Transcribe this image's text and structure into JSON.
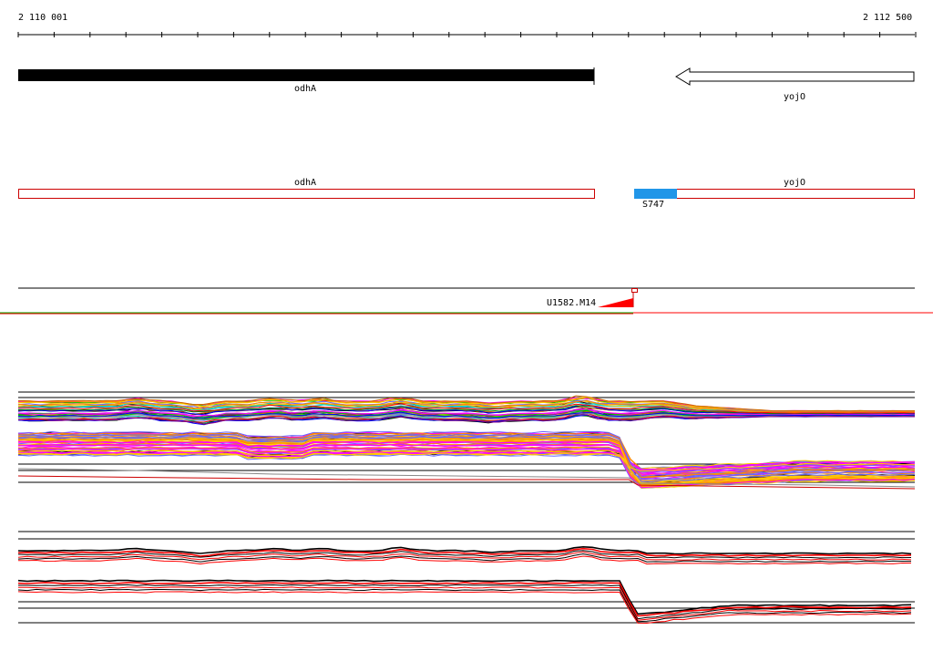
{
  "ruler": {
    "start_label": "2 110 001",
    "end_label": "2 112 500"
  },
  "genes": [
    {
      "name": "odhA",
      "strand": "+"
    },
    {
      "name": "yojO",
      "strand": "-"
    }
  ],
  "transcript_track": {
    "segments": [
      {
        "name": "odhA"
      },
      {
        "name": "yojO"
      }
    ],
    "feature": {
      "name": "S747"
    }
  },
  "probe": {
    "label": "U1582.M14"
  },
  "colors": {
    "gene_forward": "#000000",
    "gene_reverse": "#ffffff",
    "segment_outline": "#cc0000",
    "feature_fill": "#2196e8",
    "probe_marker": "#ff0000",
    "green_line": "#00aa00",
    "red_line": "#ff0000"
  },
  "series_palette": [
    "#ff00ff",
    "#00cc00",
    "#0000ff",
    "#ff8800",
    "#00cccc",
    "#880088",
    "#ffcc00",
    "#008800",
    "#ff0000",
    "#6666ff",
    "#cc6600",
    "#999999"
  ]
}
